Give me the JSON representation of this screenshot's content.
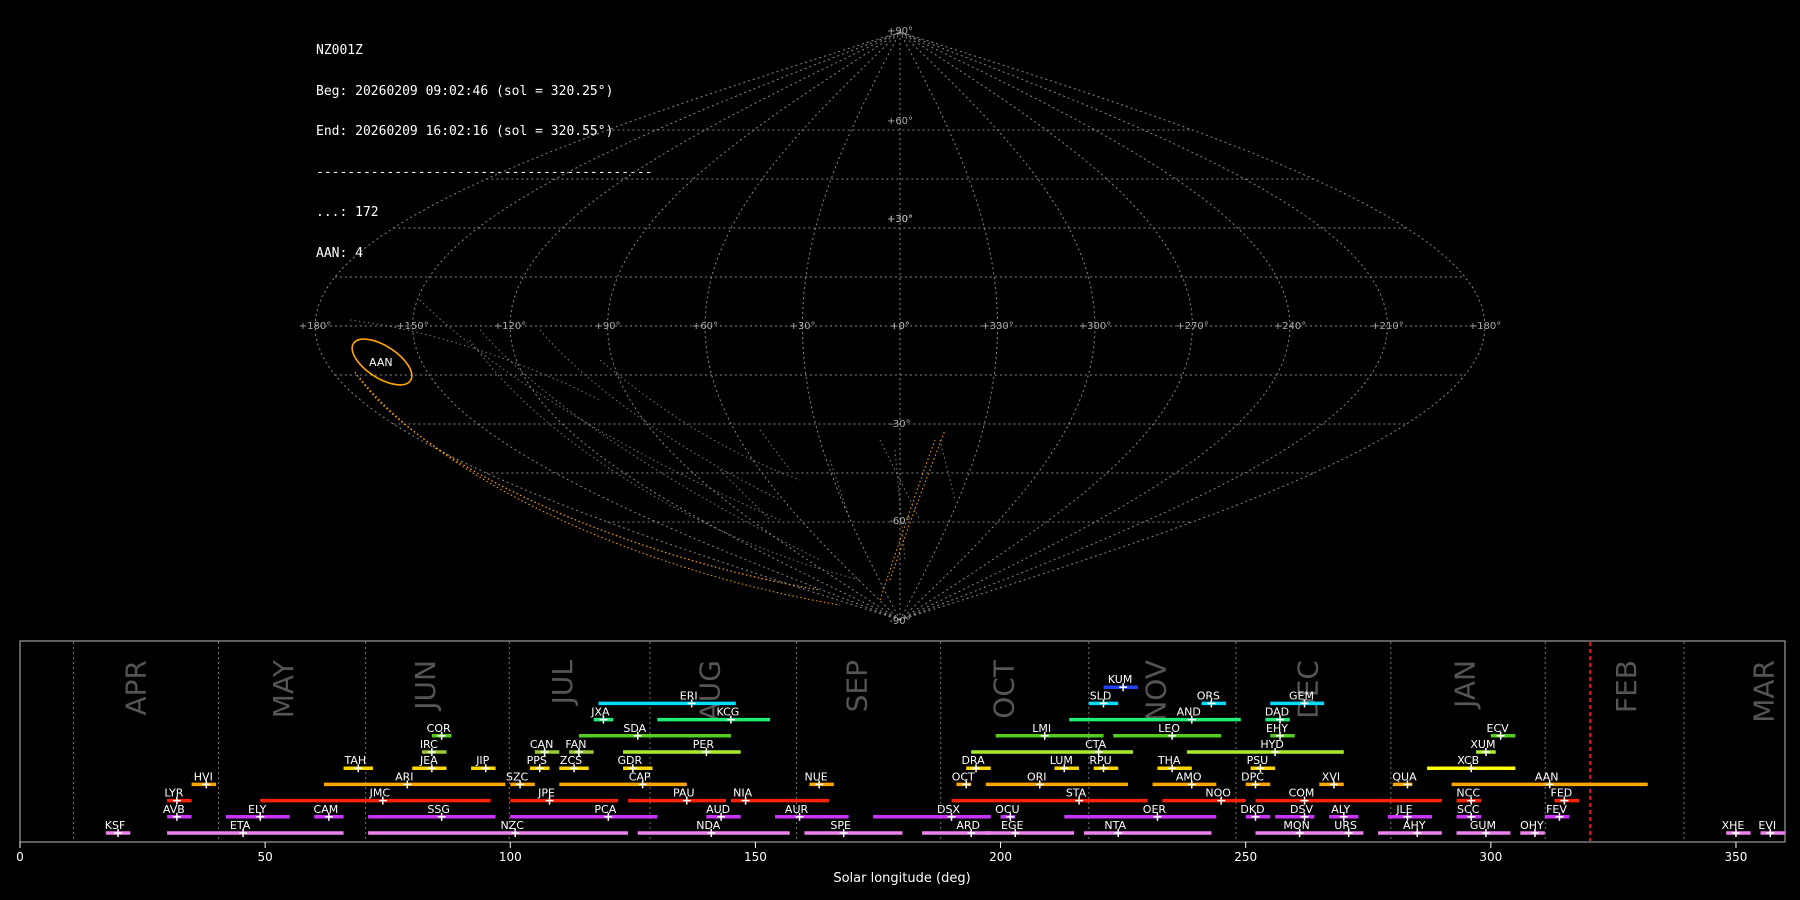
{
  "header": {
    "station": "NZ001Z",
    "beg": "Beg: 20260209 09:02:46 (sol = 320.25°)",
    "end": "End: 20260209 16:02:16 (sol = 320.55°)",
    "divider": "-------------------------------------------",
    "sporadic_count": "...: 172",
    "aan_count": "AAN: 4"
  },
  "sky_map": {
    "projection": "sinusoidal",
    "lon_labels": [
      "+180°",
      "+150°",
      "+120°",
      "+90°",
      "+60°",
      "+30°",
      "+0°",
      "+330°",
      "+300°",
      "+270°",
      "+240°",
      "+210°",
      "+180°"
    ],
    "lat_labels": [
      "+90°",
      "+60°",
      "+30°",
      "+30°",
      "+30°",
      "+0°",
      "-30°",
      "-60°",
      "-90°"
    ],
    "radiant_label": "AAN",
    "radiant_color": "#ffa500"
  },
  "chart_data": {
    "type": "timeline",
    "xlabel": "Solar longitude (deg)",
    "xlim": [
      0,
      360
    ],
    "xticks": [
      "0",
      "50",
      "100",
      "150",
      "200",
      "250",
      "300",
      "350"
    ],
    "current_sol": 320.25,
    "month_boundaries": [
      10.9,
      40.5,
      70.5,
      99.8,
      128.5,
      158.4,
      187.8,
      218.0,
      248.0,
      279.6,
      311.1,
      339.4
    ],
    "months": [
      {
        "name": "APR",
        "sol": 24
      },
      {
        "name": "MAY",
        "sol": 54
      },
      {
        "name": "JUN",
        "sol": 83
      },
      {
        "name": "JUL",
        "sol": 111
      },
      {
        "name": "AUG",
        "sol": 141
      },
      {
        "name": "SEP",
        "sol": 171
      },
      {
        "name": "OCT",
        "sol": 201
      },
      {
        "name": "NOV",
        "sol": 232
      },
      {
        "name": "DEC",
        "sol": 263
      },
      {
        "name": "JAN",
        "sol": 295
      },
      {
        "name": "FEB",
        "sol": 328
      },
      {
        "name": "MAR",
        "sol": 356
      }
    ],
    "showers": [
      {
        "code": "KSF",
        "start": 17.5,
        "end": 22.5,
        "peak": 20,
        "row": 0,
        "color": "#ee82ee"
      },
      {
        "code": "ETA",
        "start": 30,
        "end": 66,
        "peak": 45.5,
        "row": 0,
        "color": "#ee82ee"
      },
      {
        "code": "NZC",
        "start": 71,
        "end": 124,
        "peak": 101,
        "row": 0,
        "color": "#ee82ee"
      },
      {
        "code": "NDA",
        "start": 126,
        "end": 157,
        "peak": 141,
        "row": 0,
        "color": "#ee82ee"
      },
      {
        "code": "SPE",
        "start": 160,
        "end": 180,
        "peak": 168,
        "row": 0,
        "color": "#ee82ee"
      },
      {
        "code": "ARD",
        "start": 184,
        "end": 198,
        "peak": 194,
        "row": 0,
        "color": "#ee82ee"
      },
      {
        "code": "EGE",
        "start": 197,
        "end": 215,
        "peak": 203,
        "row": 0,
        "color": "#ee82ee"
      },
      {
        "code": "NTA",
        "start": 217,
        "end": 243,
        "peak": 224,
        "row": 0,
        "color": "#ee82ee"
      },
      {
        "code": "MON",
        "start": 252,
        "end": 269,
        "peak": 261,
        "row": 0,
        "color": "#ee82ee"
      },
      {
        "code": "URS",
        "start": 269,
        "end": 274,
        "peak": 271,
        "row": 0,
        "color": "#ee82ee"
      },
      {
        "code": "AHY",
        "start": 277,
        "end": 290,
        "peak": 285,
        "row": 0,
        "color": "#ee82ee"
      },
      {
        "code": "GUM",
        "start": 293,
        "end": 304,
        "peak": 299,
        "row": 0,
        "color": "#ee82ee"
      },
      {
        "code": "OHY",
        "start": 306,
        "end": 311,
        "peak": 309,
        "row": 0,
        "color": "#ee82ee"
      },
      {
        "code": "XHE",
        "start": 348,
        "end": 353,
        "peak": 350,
        "row": 0,
        "color": "#ee82ee"
      },
      {
        "code": "EVI",
        "start": 355,
        "end": 360,
        "peak": 357,
        "row": 0,
        "color": "#ee82ee"
      },
      {
        "code": "AVB",
        "start": 30,
        "end": 35,
        "peak": 32,
        "row": 1,
        "color": "#cc33ff"
      },
      {
        "code": "ELY",
        "start": 42,
        "end": 55,
        "peak": 49,
        "row": 1,
        "color": "#cc33ff"
      },
      {
        "code": "CAM",
        "start": 60,
        "end": 66,
        "peak": 63,
        "row": 1,
        "color": "#cc33ff"
      },
      {
        "code": "SSG",
        "start": 71,
        "end": 97,
        "peak": 86,
        "row": 1,
        "color": "#cc33ff"
      },
      {
        "code": "PCA",
        "start": 100,
        "end": 130,
        "peak": 120,
        "row": 1,
        "color": "#cc33ff"
      },
      {
        "code": "AUD",
        "start": 140,
        "end": 147,
        "peak": 143,
        "row": 1,
        "color": "#cc33ff"
      },
      {
        "code": "AUR",
        "start": 154,
        "end": 169,
        "peak": 159,
        "row": 1,
        "color": "#cc33ff"
      },
      {
        "code": "DSX",
        "start": 174,
        "end": 198,
        "peak": 190,
        "row": 1,
        "color": "#cc33ff"
      },
      {
        "code": "OCU",
        "start": 200,
        "end": 203,
        "peak": 202,
        "row": 1,
        "color": "#cc33ff"
      },
      {
        "code": "OER",
        "start": 213,
        "end": 244,
        "peak": 232,
        "row": 1,
        "color": "#cc33ff"
      },
      {
        "code": "DKD",
        "start": 250,
        "end": 255,
        "peak": 252,
        "row": 1,
        "color": "#cc33ff"
      },
      {
        "code": "DSV",
        "start": 256,
        "end": 264,
        "peak": 262,
        "row": 1,
        "color": "#cc33ff"
      },
      {
        "code": "ALY",
        "start": 267,
        "end": 273,
        "peak": 270,
        "row": 1,
        "color": "#cc33ff"
      },
      {
        "code": "JLE",
        "start": 279,
        "end": 288,
        "peak": 283,
        "row": 1,
        "color": "#cc33ff"
      },
      {
        "code": "SCC",
        "start": 293,
        "end": 298,
        "peak": 296,
        "row": 1,
        "color": "#cc33ff"
      },
      {
        "code": "FEV",
        "start": 311,
        "end": 316,
        "peak": 314,
        "row": 1,
        "color": "#cc33ff"
      },
      {
        "code": "LYR",
        "start": 30,
        "end": 35,
        "peak": 32,
        "row": 2,
        "color": "#ff2200"
      },
      {
        "code": "JMC",
        "start": 49,
        "end": 96,
        "peak": 74,
        "row": 2,
        "color": "#ff2200"
      },
      {
        "code": "JPE",
        "start": 100,
        "end": 122,
        "peak": 108,
        "row": 2,
        "color": "#ff2200"
      },
      {
        "code": "PAU",
        "start": 124,
        "end": 144,
        "peak": 136,
        "row": 2,
        "color": "#ff2200"
      },
      {
        "code": "NIA",
        "start": 145,
        "end": 165,
        "peak": 148,
        "row": 2,
        "color": "#ff2200"
      },
      {
        "code": "STA",
        "start": 190,
        "end": 230,
        "peak": 216,
        "row": 2,
        "color": "#ff2200"
      },
      {
        "code": "NOO",
        "start": 233,
        "end": 250,
        "peak": 245,
        "row": 2,
        "color": "#ff2200"
      },
      {
        "code": "COM",
        "start": 252,
        "end": 290,
        "peak": 262,
        "row": 2,
        "color": "#ff2200"
      },
      {
        "code": "NCC",
        "start": 293,
        "end": 298,
        "peak": 296,
        "row": 2,
        "color": "#ff2200"
      },
      {
        "code": "FED",
        "start": 313,
        "end": 318,
        "peak": 315,
        "row": 2,
        "color": "#ff2200"
      },
      {
        "code": "HVI",
        "start": 35,
        "end": 40,
        "peak": 38,
        "row": 3,
        "color": "#ffa500"
      },
      {
        "code": "ARI",
        "start": 62,
        "end": 99,
        "peak": 79,
        "row": 3,
        "color": "#ffa500"
      },
      {
        "code": "SZC",
        "start": 100,
        "end": 105,
        "peak": 102,
        "row": 3,
        "color": "#ffa500"
      },
      {
        "code": "CAP",
        "start": 110,
        "end": 136,
        "peak": 127,
        "row": 3,
        "color": "#ffa500"
      },
      {
        "code": "NUE",
        "start": 161,
        "end": 166,
        "peak": 163,
        "row": 3,
        "color": "#ffa500"
      },
      {
        "code": "OCT",
        "start": 191,
        "end": 194,
        "peak": 193,
        "row": 3,
        "color": "#ffa500"
      },
      {
        "code": "ORI",
        "start": 197,
        "end": 226,
        "peak": 208,
        "row": 3,
        "color": "#ffa500"
      },
      {
        "code": "AMO",
        "start": 231,
        "end": 244,
        "peak": 239,
        "row": 3,
        "color": "#ffa500"
      },
      {
        "code": "DPC",
        "start": 250,
        "end": 255,
        "peak": 252,
        "row": 3,
        "color": "#ffa500"
      },
      {
        "code": "XVI",
        "start": 265,
        "end": 270,
        "peak": 268,
        "row": 3,
        "color": "#ffa500"
      },
      {
        "code": "QUA",
        "start": 280,
        "end": 284,
        "peak": 283,
        "row": 3,
        "color": "#ffa500"
      },
      {
        "code": "AAN",
        "start": 292,
        "end": 332,
        "peak": 312,
        "row": 3,
        "color": "#ffa500"
      },
      {
        "code": "TAH",
        "start": 66,
        "end": 72,
        "peak": 69,
        "row": 4,
        "color": "#ffd700"
      },
      {
        "code": "JEA",
        "start": 80,
        "end": 87,
        "peak": 84,
        "row": 4,
        "color": "#ffd700"
      },
      {
        "code": "JIP",
        "start": 92,
        "end": 97,
        "peak": 95,
        "row": 4,
        "color": "#ffd700"
      },
      {
        "code": "PPS",
        "start": 104,
        "end": 108,
        "peak": 106,
        "row": 4,
        "color": "#ffd700"
      },
      {
        "code": "ZCS",
        "start": 110,
        "end": 116,
        "peak": 113,
        "row": 4,
        "color": "#ffd700"
      },
      {
        "code": "GDR",
        "start": 123,
        "end": 129,
        "peak": 125,
        "row": 4,
        "color": "#ffd700"
      },
      {
        "code": "DRA",
        "start": 193,
        "end": 198,
        "peak": 195,
        "row": 4,
        "color": "#ffd700"
      },
      {
        "code": "LUM",
        "start": 211,
        "end": 216,
        "peak": 213,
        "row": 4,
        "color": "#ffd700"
      },
      {
        "code": "RPU",
        "start": 219,
        "end": 224,
        "peak": 221,
        "row": 4,
        "color": "#ffd700"
      },
      {
        "code": "THA",
        "start": 232,
        "end": 239,
        "peak": 235,
        "row": 4,
        "color": "#ffd700"
      },
      {
        "code": "PSU",
        "start": 251,
        "end": 256,
        "peak": 253,
        "row": 4,
        "color": "#ffd700"
      },
      {
        "code": "XCB",
        "start": 287,
        "end": 305,
        "peak": 296,
        "row": 4,
        "color": "#ffff00"
      },
      {
        "code": "IRC",
        "start": 82,
        "end": 87,
        "peak": 84,
        "row": 5,
        "color": "#99cc33"
      },
      {
        "code": "CAN",
        "start": 105,
        "end": 110,
        "peak": 107,
        "row": 5,
        "color": "#99cc33"
      },
      {
        "code": "FAN",
        "start": 112,
        "end": 117,
        "peak": 114,
        "row": 5,
        "color": "#99cc33"
      },
      {
        "code": "PER",
        "start": 123,
        "end": 147,
        "peak": 140,
        "row": 5,
        "color": "#aaee33"
      },
      {
        "code": "CTA",
        "start": 194,
        "end": 227,
        "peak": 220,
        "row": 5,
        "color": "#aaee33"
      },
      {
        "code": "HYD",
        "start": 238,
        "end": 270,
        "peak": 256,
        "row": 5,
        "color": "#aaee33"
      },
      {
        "code": "XUM",
        "start": 297,
        "end": 301,
        "peak": 299,
        "row": 5,
        "color": "#aaee33"
      },
      {
        "code": "COR",
        "start": 84,
        "end": 88,
        "peak": 86,
        "row": 6,
        "color": "#55cc22"
      },
      {
        "code": "SDA",
        "start": 114,
        "end": 145,
        "peak": 126,
        "row": 6,
        "color": "#55cc22"
      },
      {
        "code": "LMI",
        "start": 199,
        "end": 221,
        "peak": 209,
        "row": 6,
        "color": "#55cc22"
      },
      {
        "code": "LEO",
        "start": 223,
        "end": 245,
        "peak": 235,
        "row": 6,
        "color": "#55cc22"
      },
      {
        "code": "EHY",
        "start": 255,
        "end": 260,
        "peak": 257,
        "row": 6,
        "color": "#55cc22"
      },
      {
        "code": "ECV",
        "start": 300,
        "end": 305,
        "peak": 302,
        "row": 6,
        "color": "#55cc22"
      },
      {
        "code": "JXA",
        "start": 117,
        "end": 121,
        "peak": 119,
        "row": 7,
        "color": "#22ee77"
      },
      {
        "code": "KCG",
        "start": 130,
        "end": 153,
        "peak": 145,
        "row": 7,
        "color": "#22ee77"
      },
      {
        "code": "AND",
        "start": 214,
        "end": 249,
        "peak": 239,
        "row": 7,
        "color": "#22ee77"
      },
      {
        "code": "DAD",
        "start": 254,
        "end": 259,
        "peak": 257,
        "row": 7,
        "color": "#22ee77"
      },
      {
        "code": "ERI",
        "start": 118,
        "end": 146,
        "peak": 137,
        "row": 8,
        "color": "#00ddff"
      },
      {
        "code": "SLD",
        "start": 218,
        "end": 224,
        "peak": 221,
        "row": 8,
        "color": "#00ddff"
      },
      {
        "code": "ORS",
        "start": 241,
        "end": 246,
        "peak": 243,
        "row": 8,
        "color": "#00ddff"
      },
      {
        "code": "GEM",
        "start": 255,
        "end": 266,
        "peak": 262,
        "row": 8,
        "color": "#00ddff"
      },
      {
        "code": "KUM",
        "start": 221,
        "end": 228,
        "peak": 225,
        "row": 9,
        "color": "#2244ff"
      }
    ]
  }
}
